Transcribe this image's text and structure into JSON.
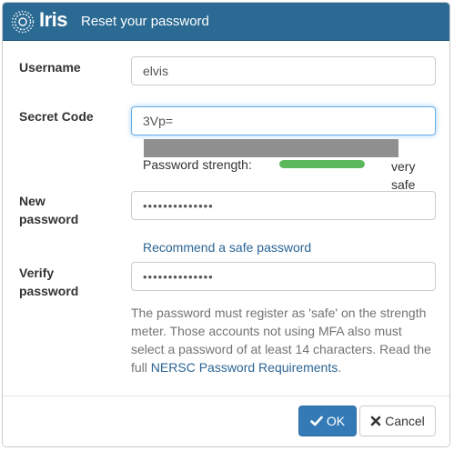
{
  "dialog": {
    "brand": "Iris",
    "title": "Reset your password"
  },
  "form": {
    "username_label": "Username",
    "username_value": "elvis",
    "secret_label": "Secret Code",
    "secret_value_visible": "3Vp=",
    "strength_label": "Password strength:",
    "strength_value": "very safe",
    "strength_level": 1.0,
    "new_password_label_line1": "New",
    "new_password_label_line2": "password",
    "new_password_value": "••••••••••••••",
    "recommend_link": "Recommend a safe password",
    "verify_label_line1": "Verify",
    "verify_label_line2": "password",
    "verify_value": "••••••••••••••",
    "help_text": "The password must register as 'safe' on the strength meter. Those accounts not using MFA also must select a password of at least 14 characters. Read the full ",
    "help_link": "NERSC Password Requirements",
    "help_suffix": "."
  },
  "footer": {
    "ok_label": "OK",
    "cancel_label": "Cancel"
  },
  "colors": {
    "header": "#2a6a93",
    "primary": "#337ab7",
    "meter": "#5cb85c",
    "link": "#2a6496"
  },
  "icons": {
    "logo": "iris-logo-icon",
    "ok": "check-icon",
    "cancel": "close-icon"
  }
}
